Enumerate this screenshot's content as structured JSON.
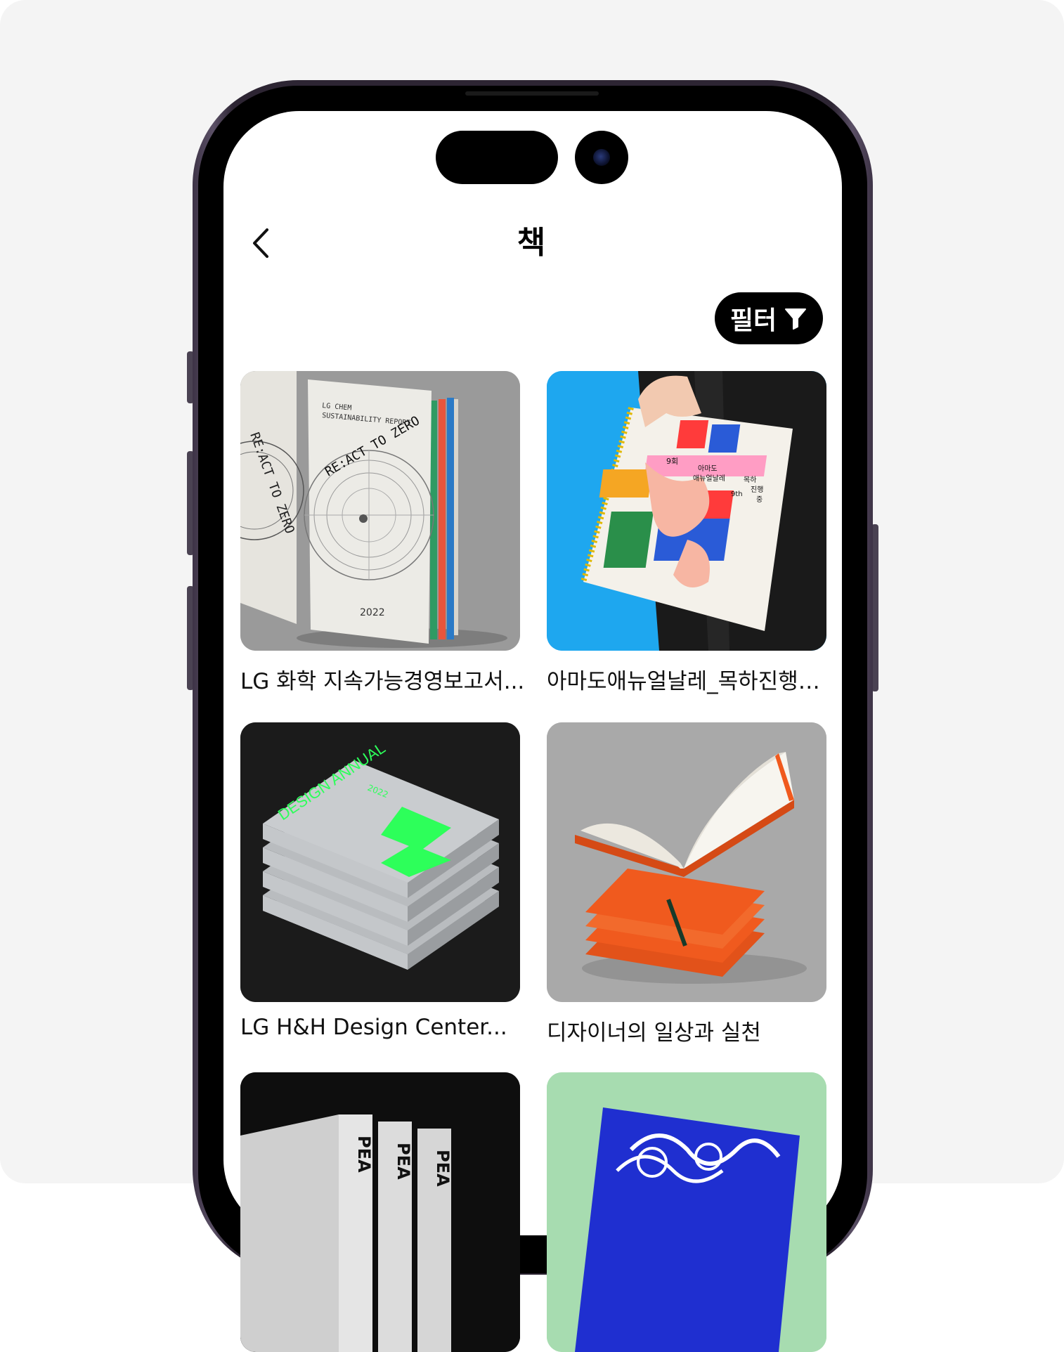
{
  "header": {
    "title": "책",
    "back_icon": "chevron-left-icon"
  },
  "filter": {
    "label": "필터",
    "icon": "funnel-icon"
  },
  "books": [
    {
      "title": "LG 화학 지속가능경영보고서...",
      "cover_texts": {
        "line1": "LG CHEM",
        "line2": "SUSTAINABILITY REPORT",
        "ring": "RE:ACT TO ZERO",
        "year": "2022"
      }
    },
    {
      "title": "아마도애뉴얼날레_목하진행중...",
      "cover_texts": {
        "a": "9회",
        "b": "아마도",
        "c": "애뉴얼날레",
        "d": "목하",
        "e": "진행",
        "f": "9th",
        "g": "중"
      }
    },
    {
      "title": "LG H&H Design Center...",
      "cover_texts": {
        "main": "DESIGN ANNUAL",
        "year": "2022",
        "num": "22"
      }
    },
    {
      "title": "디자이너의 일상과 실천"
    },
    {
      "title": "",
      "cover_texts": {
        "spine": "PEA"
      }
    },
    {
      "title": ""
    }
  ],
  "colors": {
    "accent": "#000000",
    "card1_bg": "#9a9a9a",
    "card2_bg": "#1ea7ef",
    "card3_bg": "#1b1b1b",
    "card4_bg": "#a9a9a9",
    "card5_bg": "#0e0e0e",
    "card6_bg": "#a7dcb0",
    "neon_green": "#2dff5a",
    "orange": "#f05a1e",
    "cobalt": "#1f2fd0"
  }
}
